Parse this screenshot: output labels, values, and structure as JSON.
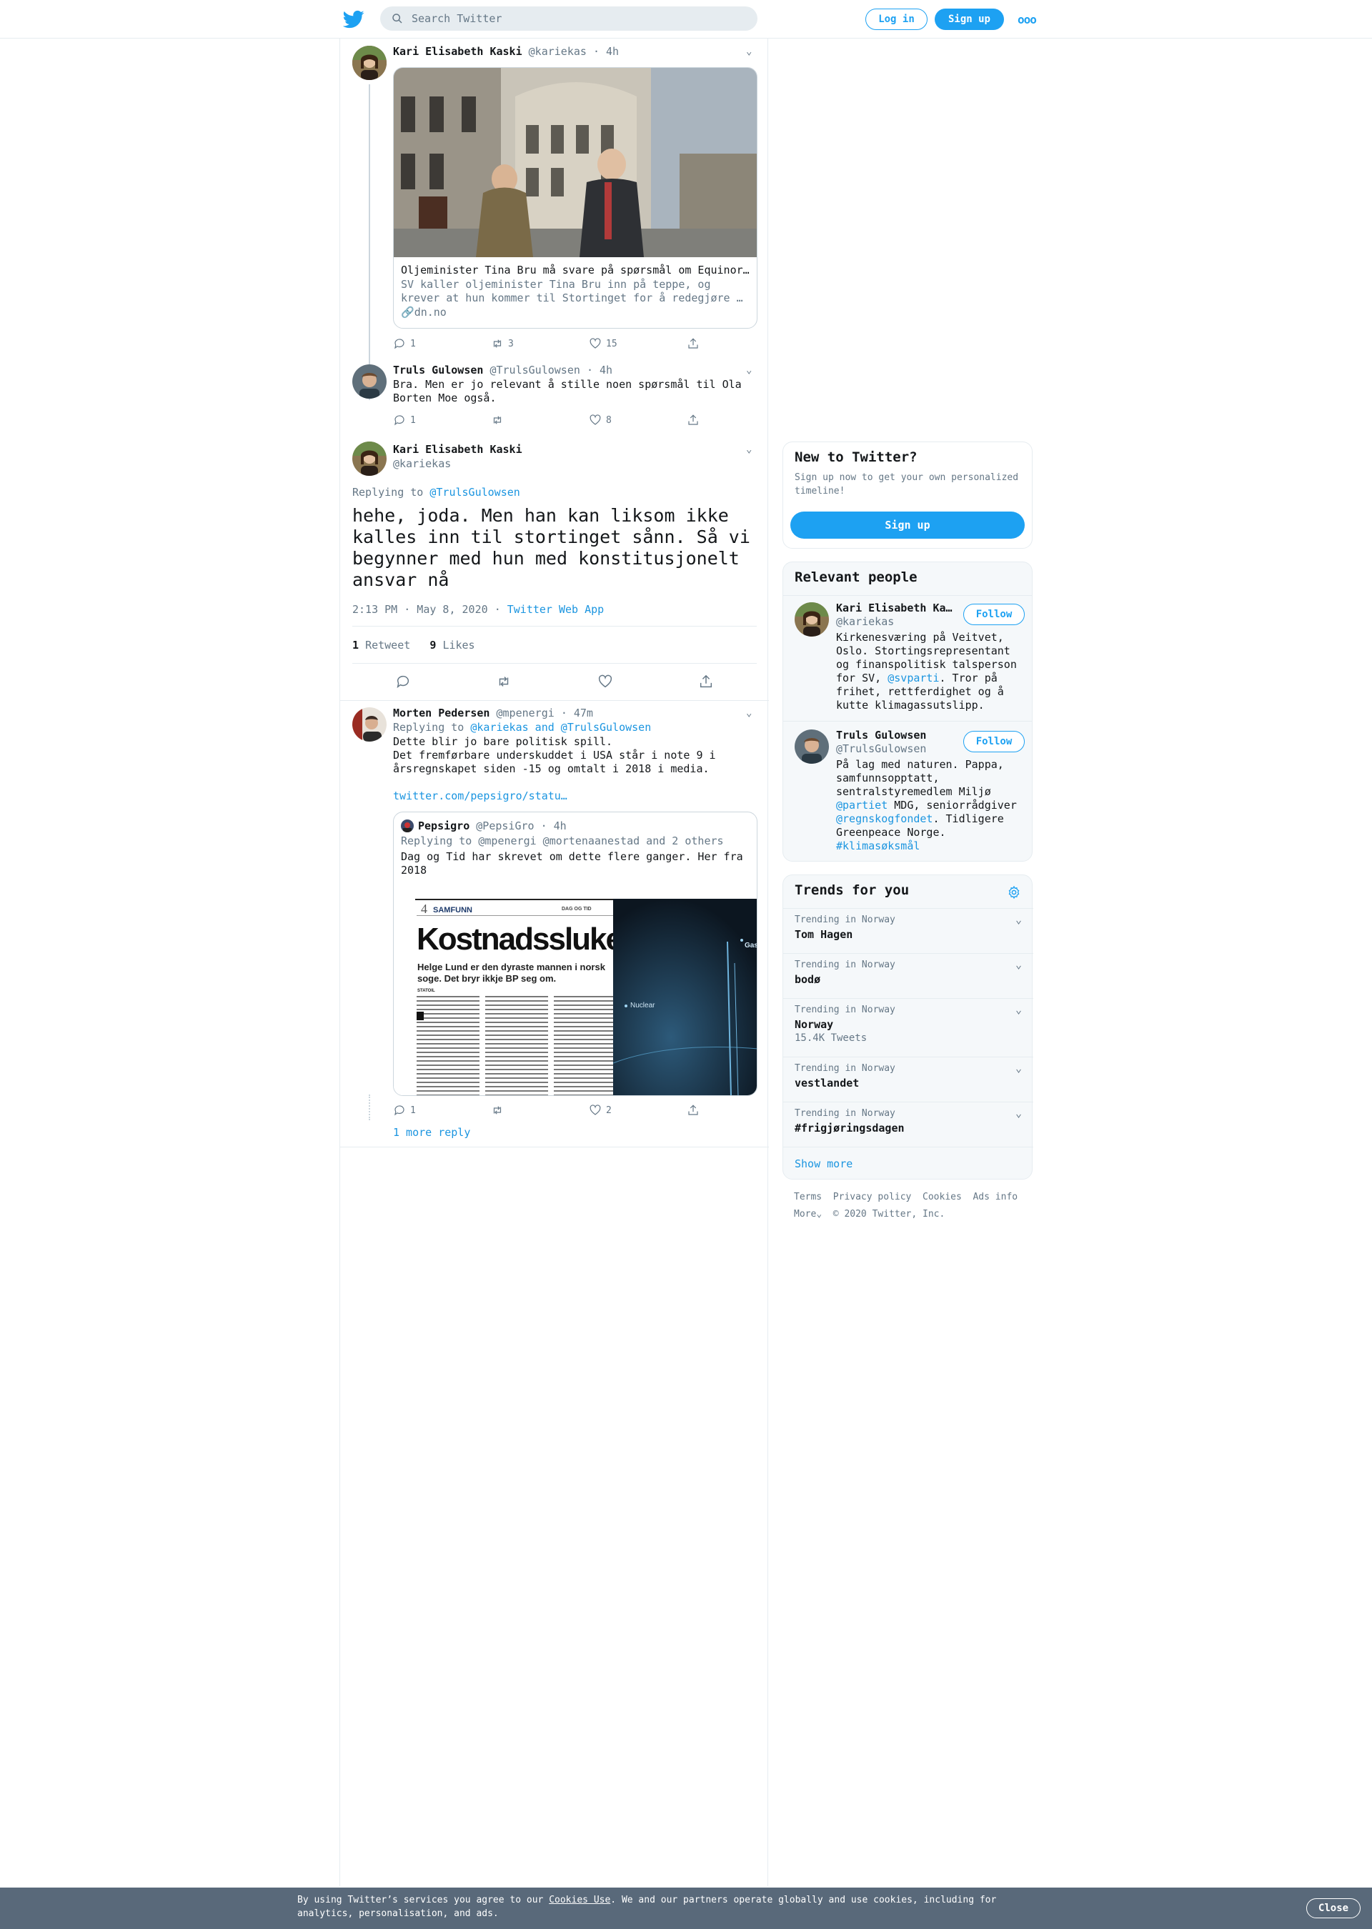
{
  "header": {
    "search_placeholder": "Search Twitter",
    "login": "Log in",
    "signup": "Sign up"
  },
  "thread": {
    "t1": {
      "name": "Kari Elisabeth Kaski",
      "handle": "@kariekas",
      "time": "· 4h",
      "card_title": "Oljeminister Tina Bru må svare på spørsmål om Equinor…",
      "card_desc_line1": "SV kaller oljeminister Tina Bru inn på teppe, og",
      "card_desc_line2": "krever at hun kommer til Stortinget for å redegjøre …",
      "card_domain": "dn.no",
      "replies": "1",
      "retweets": "3",
      "likes": "15"
    },
    "t2": {
      "name": "Truls Gulowsen",
      "handle": "@TrulsGulowsen",
      "time": "· 4h",
      "text_line1": "Bra. Men er jo relevant å stille noen spørsmål til Ola",
      "text_line2": "Borten Moe også.",
      "replies": "1",
      "retweets": "",
      "likes": "8"
    },
    "main": {
      "name": "Kari Elisabeth Kaski",
      "handle": "@kariekas",
      "replying_prefix": "Replying to",
      "replying_to": "@TrulsGulowsen",
      "text_line1": "hehe, joda. Men han kan liksom ikke",
      "text_line2": "kalles inn til stortinget sånn. Så vi",
      "text_line3": "begynner med hun med konstitusjonelt",
      "text_line4": "ansvar nå",
      "timestamp": "2:13 PM · May 8, 2020",
      "sep": "·",
      "source": "Twitter Web App",
      "retweet_count": "1",
      "retweet_label": "Retweet",
      "like_count": "9",
      "like_label": "Likes"
    },
    "reply": {
      "name": "Morten Pedersen",
      "handle": "@mpenergi",
      "time": "· 47m",
      "replying_prefix": "Replying to",
      "replying_to": "@kariekas and @TrulsGulowsen",
      "text_line1": "Dette blir jo bare politisk spill.",
      "text_line2": "Det fremførbare underskuddet i USA står i note 9 i",
      "text_line3": "årsregnskapet siden -15 og omtalt i 2018 i media.",
      "link": "twitter.com/pepsigro/statu…",
      "quote": {
        "name": "Pepsigro",
        "handle": "@PepsiGro",
        "time": "· 4h",
        "replying": "Replying to @mpenergi @mortenaanestad and 2 others",
        "text_line1": "Dag og Tid har skrevet om dette flere ganger. Her fra",
        "text_line2": "2018",
        "newspaper": {
          "page_num": "4",
          "section": "SAMFUNN",
          "paper": "DAG OG TID",
          "headline": "Kostnadssluket",
          "subhead_line1": "Helge Lund er den dyraste mannen i norsk",
          "subhead_line2": "soge. Det bryr ikkje BP seg om.",
          "byline": "STATOIL",
          "photo_label1": "Gas",
          "photo_label2": "Nuclear"
        }
      },
      "replies": "1",
      "retweets": "",
      "likes": "2",
      "more_replies": "1 more reply"
    }
  },
  "sidebar": {
    "new_title": "New to Twitter?",
    "new_desc_line1": "Sign up now to get your own personalized",
    "new_desc_line2": "timeline!",
    "new_signup": "Sign up",
    "relevant_title": "Relevant people",
    "people": [
      {
        "name": "Kari Elisabeth Ka…",
        "handle": "@kariekas",
        "follow": "Follow",
        "bio_line1": "Kirkenesværing på Veitvet,",
        "bio_line2": "Oslo. Stortingsrepresentant",
        "bio_line3": "og finanspolitisk talsperson",
        "bio_line4_pre": "for SV,",
        "bio_line4_link": "@svparti",
        "bio_line4_post": ". Tror på",
        "bio_line5": "frihet, rettferdighet og å",
        "bio_line6": "kutte klimagassutslipp."
      },
      {
        "name": "Truls Gulowsen",
        "handle": "@TrulsGulowsen",
        "follow": "Follow",
        "bio_line1": "På lag med naturen. Pappa,",
        "bio_line2": "samfunnsopptatt,",
        "bio_line3": "sentralstyremedlem Miljø",
        "bio_line4_link": "@partiet",
        "bio_line4_post": " MDG, seniorrådgiver",
        "bio_line5_link": "@regnskogfondet",
        "bio_line5_post": ". Tidligere",
        "bio_line6": "Greenpeace Norge.",
        "bio_line7_link": "#klimasøksmål"
      }
    ],
    "trends_title": "Trends for you",
    "trends": [
      {
        "label": "Trending in Norway",
        "name": "Tom Hagen",
        "count": ""
      },
      {
        "label": "Trending in Norway",
        "name": "bodø",
        "count": ""
      },
      {
        "label": "Trending in Norway",
        "name": "Norway",
        "count": "15.4K Tweets"
      },
      {
        "label": "Trending in Norway",
        "name": "vestlandet",
        "count": ""
      },
      {
        "label": "Trending in Norway",
        "name": "#frigjøringsdagen",
        "count": ""
      }
    ],
    "show_more": "Show more",
    "footer": {
      "terms": "Terms",
      "privacy": "Privacy policy",
      "cookies": "Cookies",
      "ads": "Ads info",
      "more": "More",
      "copyright": "© 2020 Twitter, Inc."
    }
  },
  "cookie_bar": {
    "text_pre": "By using Twitter’s services you agree to our",
    "link": "Cookies Use",
    "text_post": ". We and our partners operate globally and use cookies, including for",
    "text_line2": "analytics, personalisation, and ads.",
    "close": "Close"
  },
  "colors": {
    "accent": "#1da1f2",
    "link": "#1b95e0",
    "secondary_text": "#657786",
    "border": "#e6ecf0",
    "cookie_bar": "#59697a"
  }
}
